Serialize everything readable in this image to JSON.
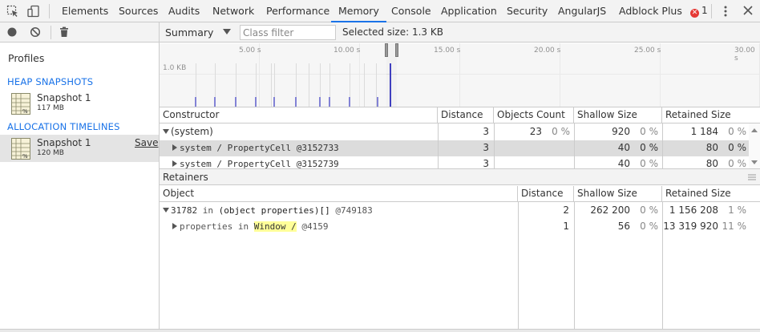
{
  "toolbar": {
    "tabs": [
      {
        "label": "Elements"
      },
      {
        "label": "Sources"
      },
      {
        "label": "Audits"
      },
      {
        "label": "Network"
      },
      {
        "label": "Performance"
      },
      {
        "label": "Memory",
        "active": true
      },
      {
        "label": "Console"
      },
      {
        "label": "Application"
      },
      {
        "label": "Security"
      },
      {
        "label": "AngularJS"
      },
      {
        "label": "Adblock Plus"
      }
    ],
    "error_count": "1",
    "accent_color": "#1a73e8",
    "icons": [
      "inspect-element-icon",
      "device-toggle-icon",
      "error-icon",
      "kebab-menu-icon",
      "close-icon"
    ]
  },
  "sidebar": {
    "title": "Profiles",
    "sections": [
      {
        "title": "HEAP SNAPSHOTS",
        "items": [
          {
            "name": "Snapshot 1",
            "size": "117 MB",
            "selected": false
          }
        ]
      },
      {
        "title": "ALLOCATION TIMELINES",
        "items": [
          {
            "name": "Snapshot 1",
            "size": "120 MB",
            "selected": true,
            "action": "Save"
          }
        ]
      }
    ],
    "toolbar_icons": [
      "record-icon",
      "clear-icon",
      "trash-icon"
    ]
  },
  "main": {
    "view_select": "Summary",
    "class_filter_placeholder": "Class filter",
    "selected_size": "Selected size: 1.3 KB",
    "timeline": {
      "ticks": [
        "5.00 s",
        "10.00 s",
        "15.00 s",
        "20.00 s",
        "25.00 s",
        "30.00 s"
      ],
      "y_label": "1.0 KB"
    },
    "constructor_table": {
      "columns": [
        "Constructor",
        "Distance",
        "Objects Count",
        "Shallow Size",
        "Retained Size"
      ],
      "rows": [
        {
          "name": "(system)",
          "expanded": true,
          "distance": "3",
          "count": "23",
          "count_pct": "0 %",
          "shallow": "920",
          "shallow_pct": "0 %",
          "retained": "1 184",
          "retained_pct": "0 %"
        },
        {
          "name_a": "system / PropertyCell",
          "id": "@3152733",
          "distance": "3",
          "count": "",
          "count_pct": "",
          "shallow": "40",
          "shallow_pct": "0 %",
          "retained": "80",
          "retained_pct": "0 %",
          "selected": true
        },
        {
          "name_a": "system / PropertyCell",
          "id": "@3152739",
          "distance": "3",
          "count": "",
          "count_pct": "",
          "shallow": "40",
          "shallow_pct": "0 %",
          "retained": "80",
          "retained_pct": "0 %"
        }
      ]
    },
    "retainers": {
      "title": "Retainers",
      "columns": [
        "Object",
        "Distance",
        "Shallow Size",
        "Retained Size"
      ],
      "rows": [
        {
          "prefix": "31782",
          "in": "in",
          "obj": "(object properties)[]",
          "id": "@749183",
          "distance": "2",
          "shallow": "262 200",
          "shallow_pct": "0 %",
          "retained": "1 156 208",
          "retained_pct": "1 %"
        },
        {
          "prefix": "properties",
          "in": "in",
          "obj": "Window /",
          "id": "@4159",
          "distance": "1",
          "shallow": "56",
          "shallow_pct": "0 %",
          "retained": "13 319 920",
          "retained_pct": "11 %"
        }
      ]
    }
  }
}
